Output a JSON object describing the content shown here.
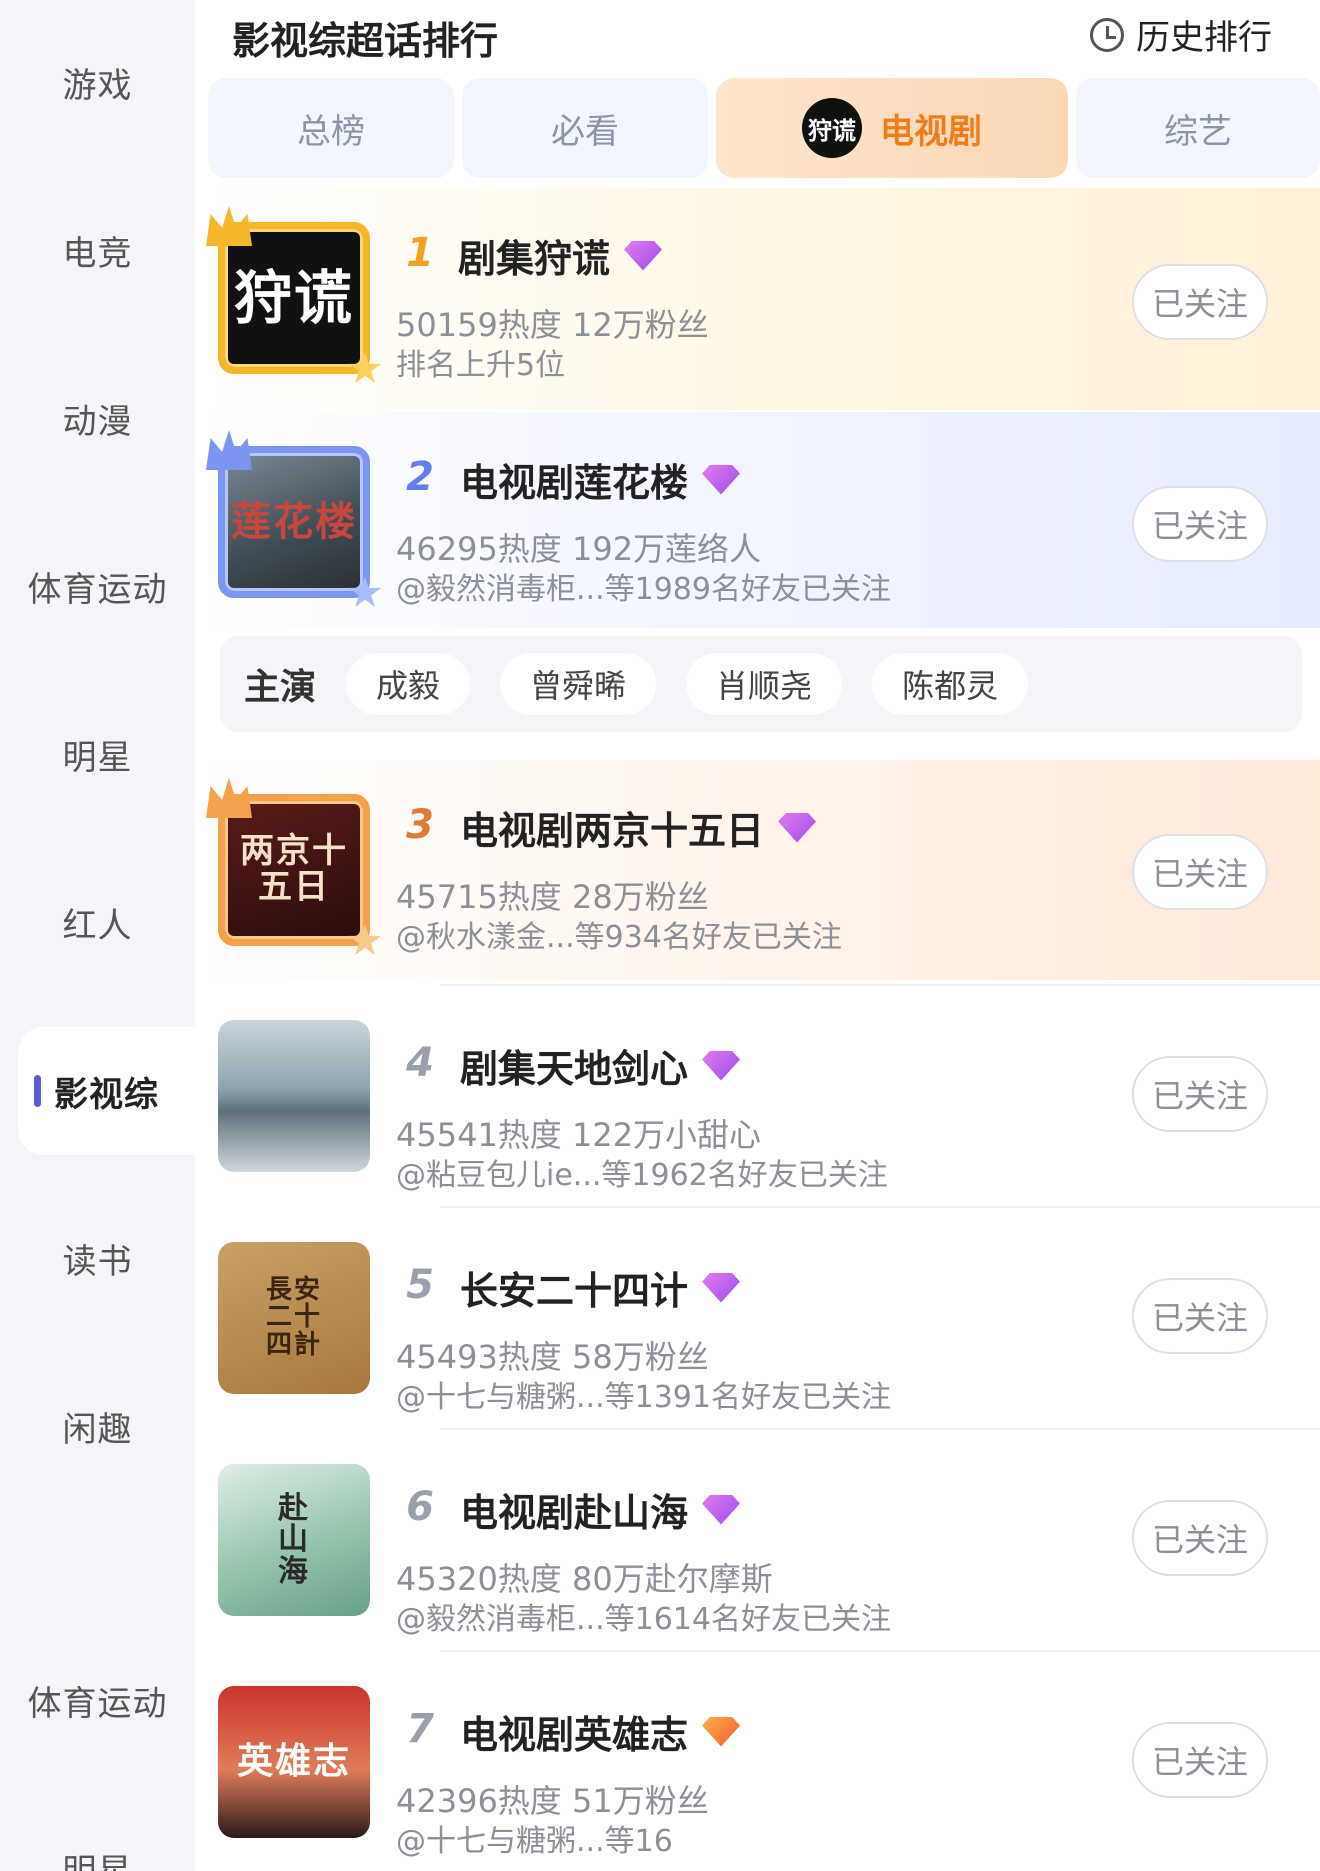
{
  "header": {
    "title": "影视综超话排行",
    "history_label": "历史排行"
  },
  "sidebar": {
    "items": [
      {
        "label": "游戏"
      },
      {
        "label": "电竞"
      },
      {
        "label": "动漫"
      },
      {
        "label": "体育运动"
      },
      {
        "label": "明星"
      },
      {
        "label": "红人"
      },
      {
        "label": "影视综",
        "active": true
      },
      {
        "label": "读书"
      },
      {
        "label": "闲趣"
      },
      {
        "label": "体育运动"
      },
      {
        "label": "明星"
      }
    ]
  },
  "tabs": [
    {
      "label": "总榜"
    },
    {
      "label": "必看"
    },
    {
      "label": "电视剧",
      "active": true,
      "logo": "狩谎"
    },
    {
      "label": "综艺"
    }
  ],
  "follow_label": "已关注",
  "list": [
    {
      "rank": "1",
      "name": "剧集狩谎",
      "stats": "50159热度 12万粉丝",
      "sub": "排名上升5位",
      "poster_text": "狩谎",
      "gem": "purple"
    },
    {
      "rank": "2",
      "name": "电视剧莲花楼",
      "stats": "46295热度 192万莲络人",
      "sub": "@毅然消毒柜...等1989名好友已关注",
      "poster_text": "莲花楼",
      "gem": "purple"
    },
    {
      "rank": "3",
      "name": "电视剧两京十五日",
      "stats": "45715热度 28万粉丝",
      "sub": "@秋水漾金...等934名好友已关注",
      "poster_text": "两京十五日",
      "gem": "purple"
    },
    {
      "rank": "4",
      "name": "剧集天地剑心",
      "stats": "45541热度 122万小甜心",
      "sub": "@粘豆包儿ie...等1962名好友已关注",
      "poster_text": "",
      "gem": "purple"
    },
    {
      "rank": "5",
      "name": "长安二十四计",
      "stats": "45493热度 58万粉丝",
      "sub": "@十七与糖粥...等1391名好友已关注",
      "poster_text": "長安二十四計",
      "gem": "purple"
    },
    {
      "rank": "6",
      "name": "电视剧赴山海",
      "stats": "45320热度 80万赴尔摩斯",
      "sub": "@毅然消毒柜...等1614名好友已关注",
      "poster_text": "赴山海",
      "gem": "purple"
    },
    {
      "rank": "7",
      "name": "电视剧英雄志",
      "stats": "42396热度 51万粉丝",
      "sub": "@十七与糖粥...等16",
      "poster_text": "英雄志",
      "gem": "orange"
    }
  ],
  "cast": {
    "label": "主演",
    "members": [
      "成毅",
      "曾舜晞",
      "肖顺尧",
      "陈都灵"
    ]
  }
}
